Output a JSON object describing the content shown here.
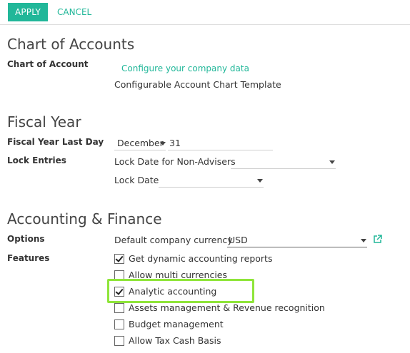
{
  "toolbar": {
    "apply_label": "APPLY",
    "cancel_label": "CANCEL"
  },
  "chart_of_accounts": {
    "title": "Chart of Accounts",
    "field_label": "Chart of Account",
    "configure_link": "Configure your company data",
    "template_value": "Configurable Account Chart Template"
  },
  "fiscal_year": {
    "title": "Fiscal Year",
    "last_day_label": "Fiscal Year Last Day",
    "month_value": "December",
    "day_value": "31",
    "lock_entries_label": "Lock Entries",
    "lock_non_advisers_label": "Lock Date for Non-Advisers",
    "lock_non_advisers_value": "",
    "lock_date_label": "Lock Date",
    "lock_date_value": ""
  },
  "accounting_finance": {
    "title": "Accounting & Finance",
    "options_label": "Options",
    "currency_label": "Default company currency",
    "currency_value": "USD",
    "features_label": "Features",
    "features": [
      {
        "label": "Get dynamic accounting reports",
        "checked": true
      },
      {
        "label": "Allow multi currencies",
        "checked": false
      },
      {
        "label": "Analytic accounting",
        "checked": true,
        "highlighted": true
      },
      {
        "label": "Assets management & Revenue recognition",
        "checked": false
      },
      {
        "label": "Budget management",
        "checked": false
      },
      {
        "label": "Allow Tax Cash Basis",
        "checked": false
      }
    ]
  },
  "colors": {
    "accent": "#21b799",
    "highlight": "#8fe53a"
  }
}
